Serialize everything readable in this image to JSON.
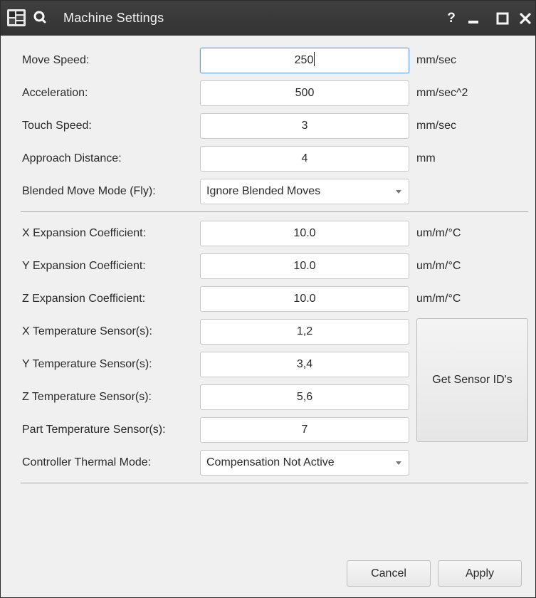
{
  "window": {
    "title": "Machine Settings",
    "help_label": "?"
  },
  "motion": {
    "move_speed": {
      "label": "Move Speed:",
      "value": "250",
      "unit": "mm/sec"
    },
    "acceleration": {
      "label": "Acceleration:",
      "value": "500",
      "unit": "mm/sec^2"
    },
    "touch_speed": {
      "label": "Touch Speed:",
      "value": "3",
      "unit": "mm/sec"
    },
    "approach_distance": {
      "label": "Approach Distance:",
      "value": "4",
      "unit": "mm"
    },
    "blended_mode": {
      "label": "Blended Move Mode (Fly):",
      "selected": "Ignore Blended Moves"
    }
  },
  "thermal": {
    "x_coeff": {
      "label": "X Expansion Coefficient:",
      "value": "10.0",
      "unit": "um/m/°C"
    },
    "y_coeff": {
      "label": "Y Expansion Coefficient:",
      "value": "10.0",
      "unit": "um/m/°C"
    },
    "z_coeff": {
      "label": "Z Expansion Coefficient:",
      "value": "10.0",
      "unit": "um/m/°C"
    },
    "x_sensors": {
      "label": "X Temperature Sensor(s):",
      "value": "1,2"
    },
    "y_sensors": {
      "label": "Y Temperature Sensor(s):",
      "value": "3,4"
    },
    "z_sensors": {
      "label": "Z Temperature Sensor(s):",
      "value": "5,6"
    },
    "part_sensors": {
      "label": "Part Temperature Sensor(s):",
      "value": "7"
    },
    "controller_mode": {
      "label": "Controller Thermal Mode:",
      "selected": "Compensation Not Active"
    },
    "get_sensor_ids_label": "Get Sensor ID's"
  },
  "footer": {
    "cancel_label": "Cancel",
    "apply_label": "Apply"
  },
  "icons": {
    "app": "machine-app-icon",
    "search": "search-icon",
    "help": "help-icon",
    "minimize": "minimize-icon",
    "maximize": "maximize-icon",
    "close": "close-icon",
    "dropdown": "chevron-down-icon"
  }
}
